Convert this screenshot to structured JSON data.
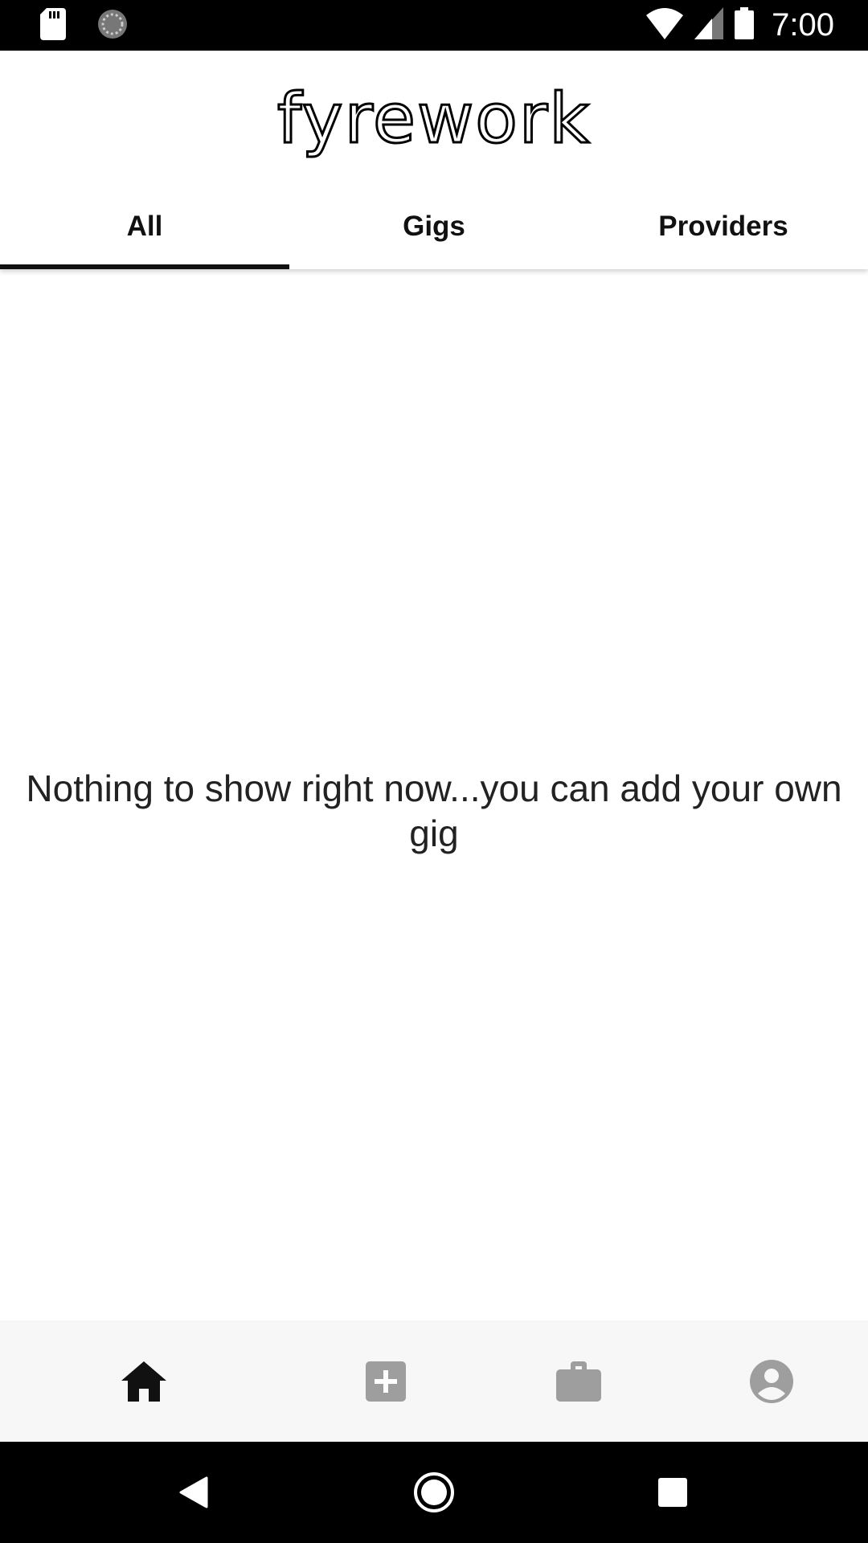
{
  "status_bar": {
    "time": "7:00",
    "icons": [
      "sd-card-icon",
      "sync-icon",
      "wifi-icon",
      "cell-signal-icon",
      "battery-icon"
    ]
  },
  "header": {
    "logo_text": "fyrework",
    "tabs": [
      {
        "label": "All",
        "active": true
      },
      {
        "label": "Gigs",
        "active": false
      },
      {
        "label": "Providers",
        "active": false
      }
    ]
  },
  "main": {
    "empty_message": "Nothing to show right now...you can add your own gig"
  },
  "bottom_nav": {
    "items": [
      {
        "icon": "home-icon",
        "active": true
      },
      {
        "icon": "add-box-icon",
        "active": false
      },
      {
        "icon": "briefcase-icon",
        "active": false
      },
      {
        "icon": "account-circle-icon",
        "active": false
      }
    ]
  },
  "system_nav": {
    "items": [
      "back-icon",
      "home-circle-icon",
      "recents-icon"
    ]
  },
  "colors": {
    "active_icon": "#111111",
    "inactive_icon": "#9e9e9e",
    "bottom_nav_bg": "#f7f7f7"
  }
}
